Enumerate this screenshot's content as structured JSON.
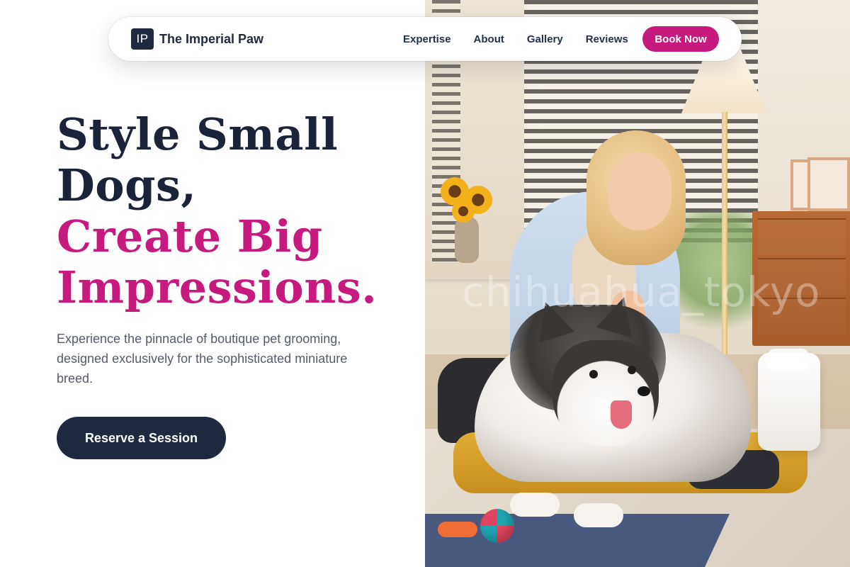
{
  "brand": {
    "logo_mark": "IP",
    "name": "The Imperial Paw"
  },
  "nav": {
    "links": [
      "Expertise",
      "About",
      "Gallery",
      "Reviews"
    ],
    "cta_label": "Book Now"
  },
  "hero": {
    "headline_lines": [
      "Style Small",
      "Dogs,"
    ],
    "accent_lines": [
      "Create Big",
      "Impressions."
    ],
    "description": "Experience the pinnacle of boutique pet grooming, designed exclusively for the sophisticated miniature breed.",
    "cta_label": "Reserve a Session"
  },
  "photo": {
    "watermark": "chihuahua_tokyo"
  },
  "colors": {
    "navy": "#1f2a3f",
    "accent_magenta": "#c71a7e",
    "body_text": "#555b68"
  },
  "icons": {
    "brand": "ip-logo-mark"
  }
}
